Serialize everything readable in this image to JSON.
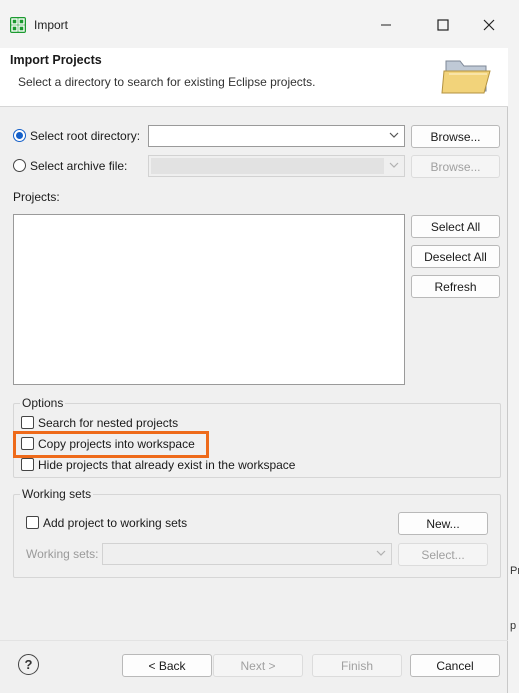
{
  "window": {
    "title": "Import"
  },
  "header": {
    "title": "Import Projects",
    "description": "Select a directory to search for existing Eclipse projects."
  },
  "source": {
    "root_label": "Select root directory:",
    "root_value": "",
    "archive_label": "Select archive file:",
    "archive_value": "",
    "browse_label": "Browse...",
    "browse_archive_label": "Browse..."
  },
  "projects": {
    "label": "Projects:",
    "select_all": "Select All",
    "deselect_all": "Deselect All",
    "refresh": "Refresh"
  },
  "options": {
    "label": "Options",
    "nested": "Search for nested projects",
    "copy": "Copy projects into workspace",
    "hide": "Hide projects that already exist in the workspace"
  },
  "working_sets": {
    "label": "Working sets",
    "add": "Add project to working sets",
    "new": "New...",
    "sets_label": "Working sets:",
    "select": "Select..."
  },
  "footer": {
    "help": "?",
    "back": "< Back",
    "next": "Next >",
    "finish": "Finish",
    "cancel": "Cancel"
  },
  "background_edge": {
    "text_1": "Pr",
    "text_2": "p"
  },
  "colors": {
    "accent": "#1560c9",
    "highlight": "#ee6a1a",
    "app_icon": "#1b9a2f"
  }
}
